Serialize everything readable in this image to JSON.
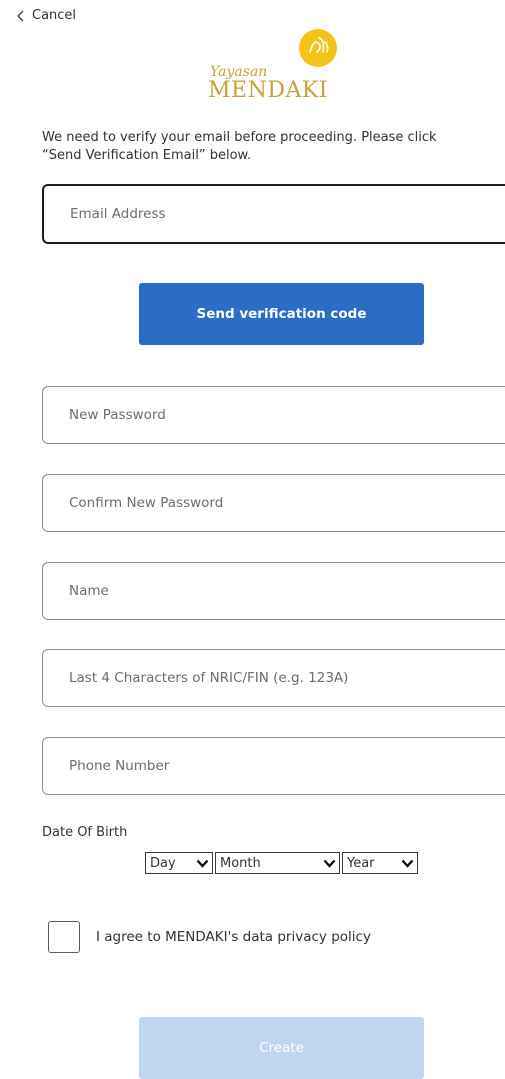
{
  "cancel": {
    "label": "Cancel"
  },
  "logo": {
    "script_text": "Yayasan",
    "brand_text": "MENDAKI"
  },
  "intro": {
    "line1": "We need to verify your email before proceeding. Please click",
    "line2": "“Send Verification Email” below."
  },
  "email": {
    "placeholder": "Email Address",
    "value": ""
  },
  "send_code": {
    "label": "Send verification code"
  },
  "new_password": {
    "placeholder": "New Password",
    "value": ""
  },
  "confirm_password": {
    "placeholder": "Confirm New Password",
    "value": ""
  },
  "name": {
    "placeholder": "Name",
    "value": ""
  },
  "nric": {
    "placeholder": "Last 4 Characters of NRIC/FIN (e.g. 123A)",
    "value": ""
  },
  "phone": {
    "placeholder": "Phone Number",
    "value": ""
  },
  "dob": {
    "label": "Date Of Birth",
    "day": "Day",
    "month": "Month",
    "year": "Year"
  },
  "agree": {
    "label": "I agree to MENDAKI's data privacy policy",
    "checked": false
  },
  "create": {
    "label": "Create"
  },
  "colors": {
    "primary": "#2b6cc4",
    "disabled": "#bfd5f0",
    "logo_gold": "#f4c21a"
  },
  "icons": {
    "cancel": "chevron-left-icon",
    "dropdown": "chevron-down-icon",
    "logo_mark": "logo-emblem"
  }
}
